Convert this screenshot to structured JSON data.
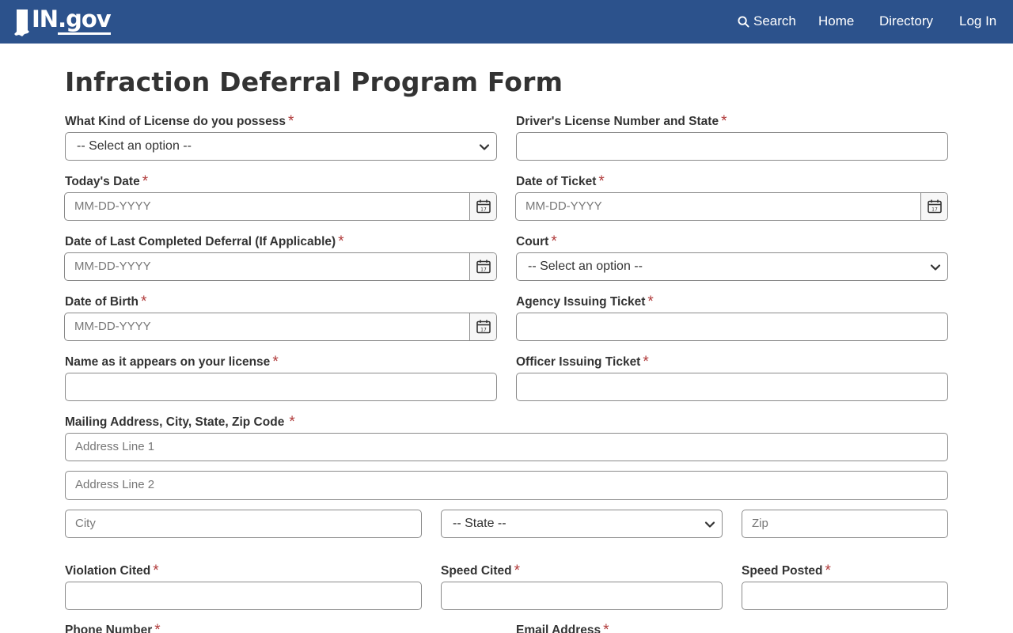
{
  "header": {
    "logo_text_in": "IN",
    "logo_text_gov": ".gov",
    "nav": {
      "search": "Search",
      "home": "Home",
      "directory": "Directory",
      "login": "Log In"
    },
    "bg_color": "#2c528c"
  },
  "form": {
    "title": "Infraction Deferral Program Form",
    "required_mark": "*",
    "required_color": "#b03a3a",
    "license_kind": {
      "label": "What Kind of License do you possess",
      "value": "-- Select an option --"
    },
    "license_number": {
      "label": "Driver's License Number and State",
      "value": ""
    },
    "todays_date": {
      "label": "Today's Date",
      "placeholder": "MM-DD-YYYY"
    },
    "ticket_date": {
      "label": "Date of Ticket",
      "placeholder": "MM-DD-YYYY"
    },
    "last_deferral": {
      "label": "Date of Last Completed Deferral (If Applicable)",
      "placeholder": "MM-DD-YYYY"
    },
    "court": {
      "label": "Court",
      "value": "-- Select an option --"
    },
    "birth_date": {
      "label": "Date of Birth",
      "placeholder": "MM-DD-YYYY"
    },
    "agency": {
      "label": "Agency Issuing Ticket",
      "value": ""
    },
    "name": {
      "label": "Name as it appears on your license",
      "value": ""
    },
    "officer": {
      "label": "Officer Issuing Ticket",
      "value": ""
    },
    "address": {
      "label": "Mailing Address, City, State, Zip Code",
      "line1_placeholder": "Address Line 1",
      "line2_placeholder": "Address Line 2",
      "city_placeholder": "City",
      "state_value": "-- State --",
      "zip_placeholder": "Zip"
    },
    "violation": {
      "label": "Violation Cited",
      "value": ""
    },
    "speed_cited": {
      "label": "Speed Cited",
      "value": ""
    },
    "speed_posted": {
      "label": "Speed Posted",
      "value": ""
    },
    "phone": {
      "label": "Phone Number"
    },
    "email": {
      "label": "Email Address"
    }
  }
}
